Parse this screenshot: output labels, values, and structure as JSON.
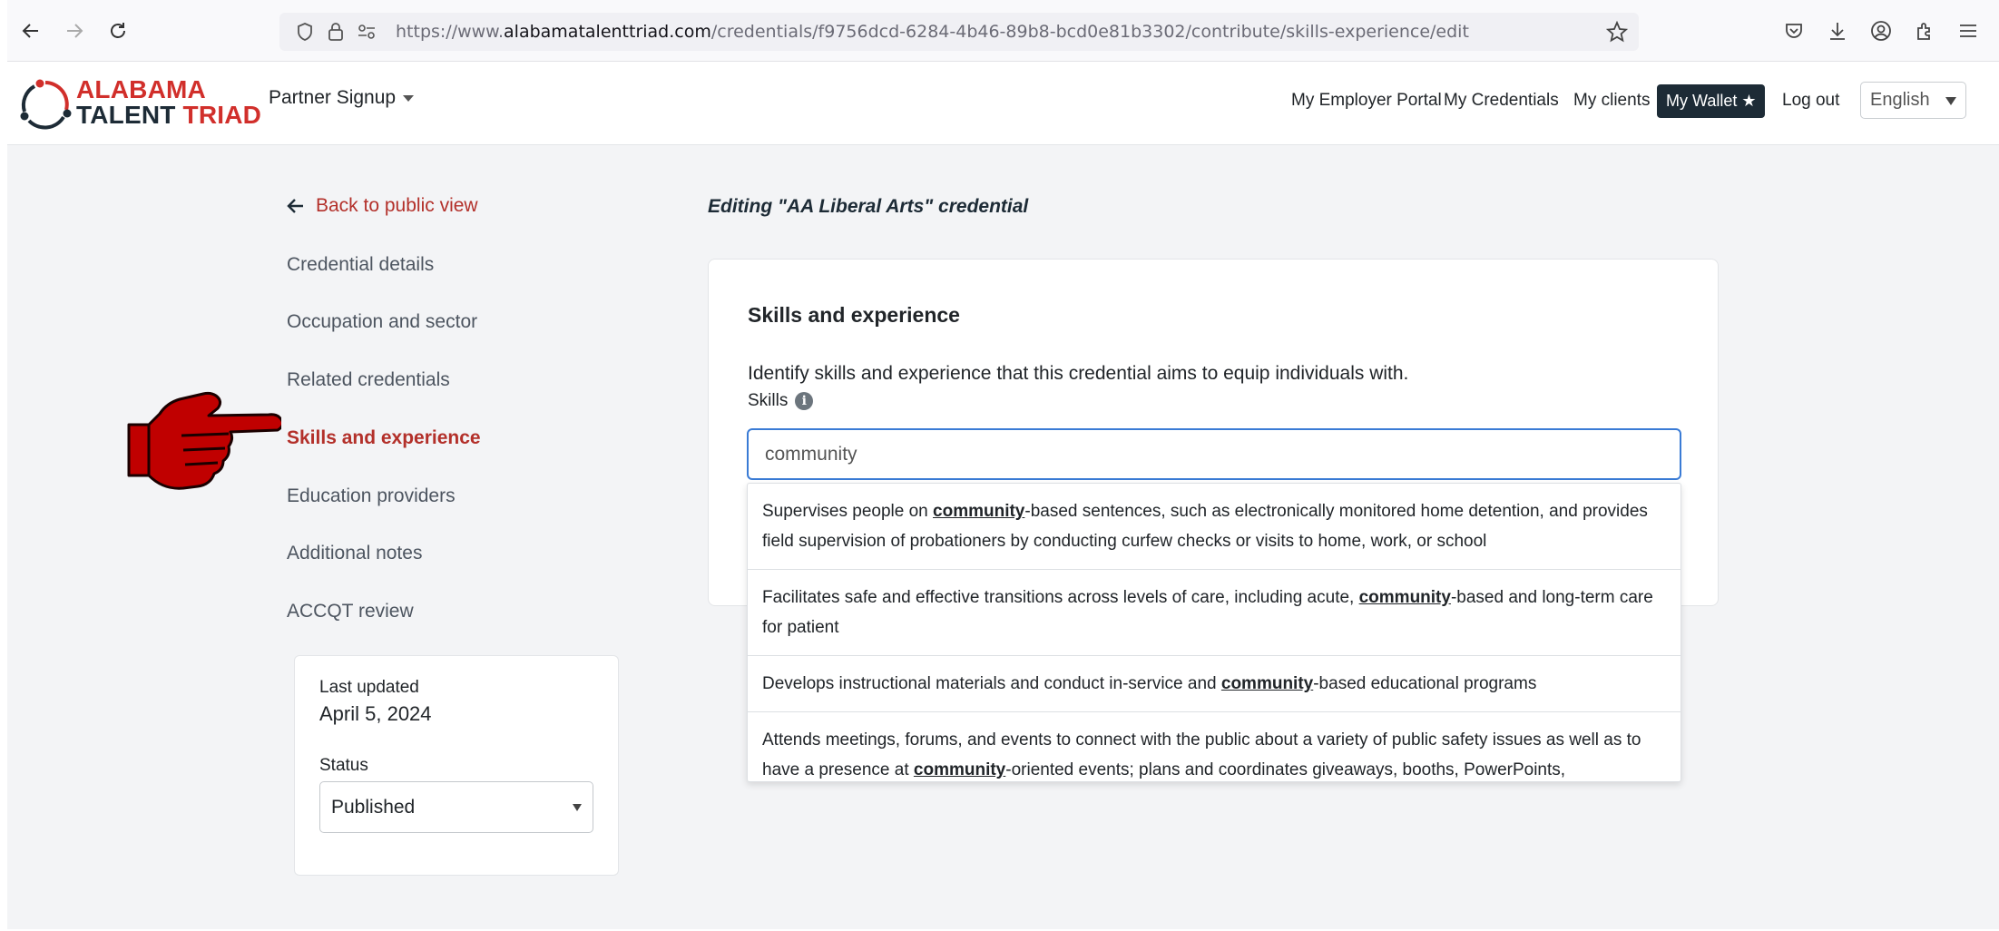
{
  "browser": {
    "url_prefix": "https://www.",
    "url_domain": "alabamatalenttriad.com",
    "url_path": "/credentials/f9756dcd-6284-4b46-89b8-bcd0e81b3302/contribute/skills-experience/edit"
  },
  "header": {
    "logo_line1": "ALABAMA",
    "logo_line2a": "TALENT",
    "logo_line2b": "TRIAD",
    "partner_signup": "Partner Signup",
    "nav": [
      "My Employer Portal",
      "My Credentials",
      "My clients"
    ],
    "wallet": "My Wallet ★",
    "logout": "Log out",
    "language": "English"
  },
  "sidebar": {
    "back": "Back to public view",
    "items": [
      "Credential details",
      "Occupation and sector",
      "Related credentials",
      "Skills and experience",
      "Education providers",
      "Additional notes",
      "ACCQT review"
    ],
    "last_updated_label": "Last updated",
    "last_updated_value": "April 5, 2024",
    "status_label": "Status",
    "status_value": "Published"
  },
  "main": {
    "editing_title": "Editing \"AA Liberal Arts\" credential",
    "card_title": "Skills and experience",
    "description": "Identify skills and experience that this credential aims to equip individuals with.",
    "skills_label": "Skills",
    "skills_input_value": "community",
    "suggestions": [
      {
        "pre": "Supervises people on ",
        "match": "community",
        "post": "-based sentences, such as electronically monitored home detention, and provides field supervision of probationers by conducting curfew checks or visits to home, work, or school"
      },
      {
        "pre": "Facilitates safe and effective transitions across levels of care, including acute, ",
        "match": "community",
        "post": "-based and long-term care for patient"
      },
      {
        "pre": "Develops instructional materials and conduct in-service and ",
        "match": "community",
        "post": "-based educational programs"
      },
      {
        "pre": "Attends meetings, forums, and events to connect with the public about a variety of public safety issues as well as to have a presence at ",
        "match": "community",
        "post": "-oriented events; plans and coordinates giveaways, booths, PowerPoints,"
      }
    ]
  },
  "colors": {
    "brand_red": "#b3302a",
    "brand_dark": "#1d2b36",
    "focus_blue": "#3a7bd5"
  }
}
